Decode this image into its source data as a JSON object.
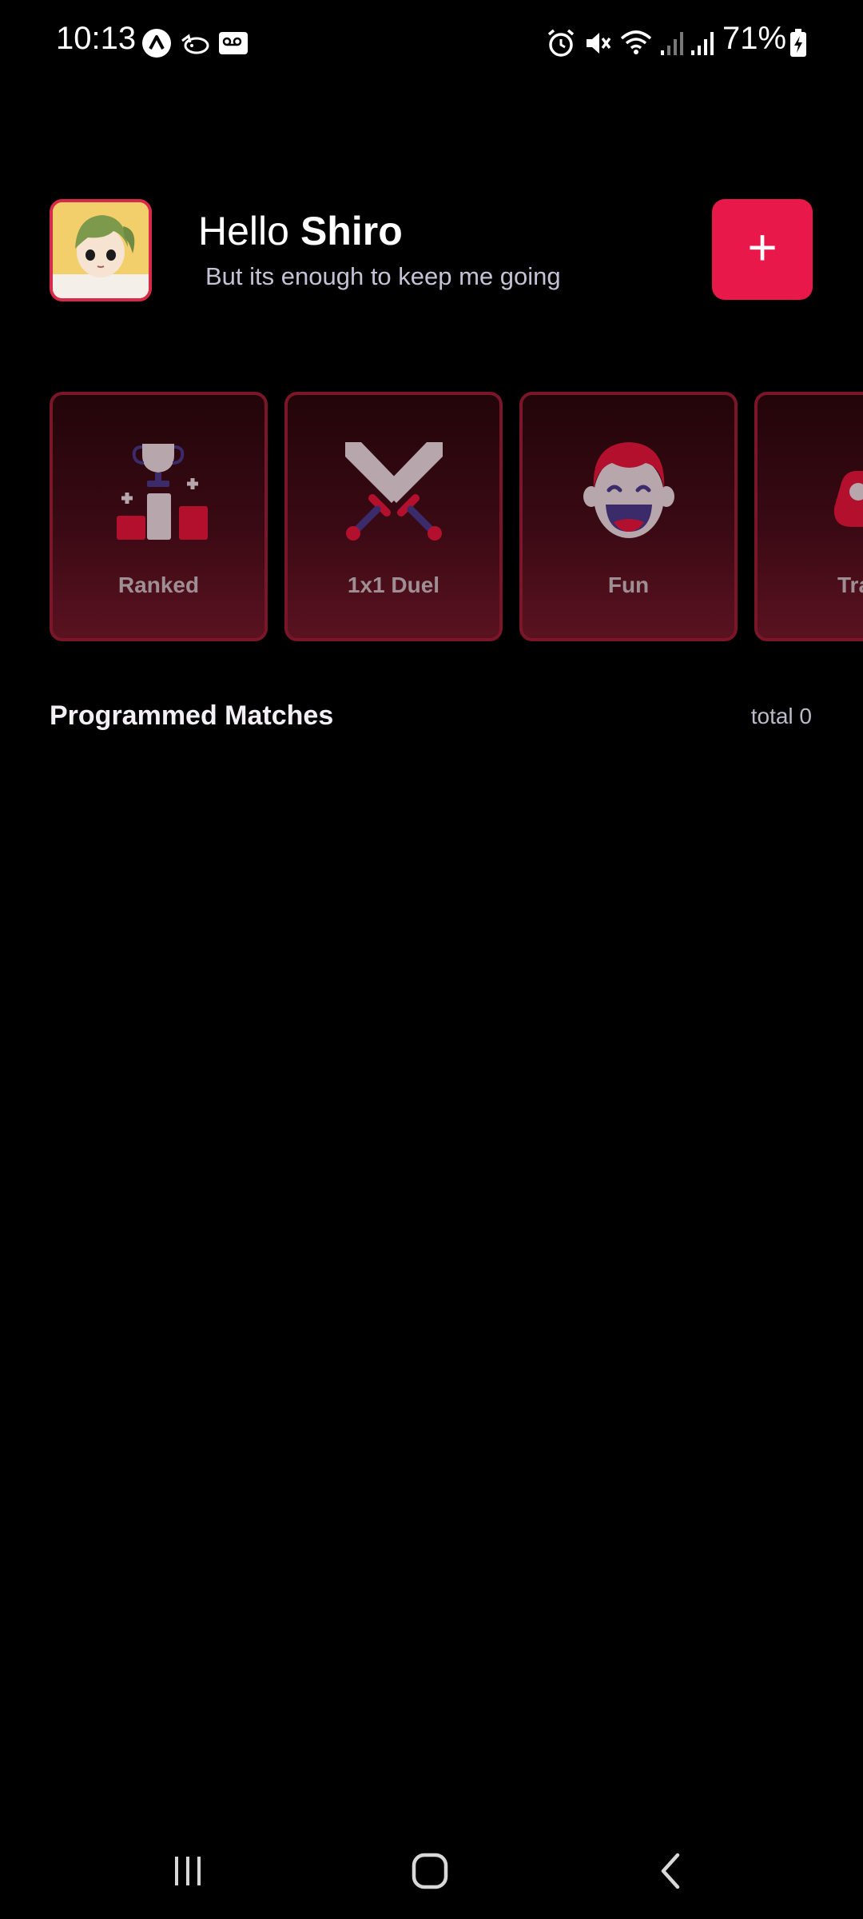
{
  "status_bar": {
    "time": "10:13",
    "battery_percent": "71%",
    "icons": [
      "app-a-icon",
      "cat-icon",
      "voicemail-icon",
      "alarm-icon",
      "mute-icon",
      "wifi-icon",
      "signal-icon",
      "signal-icon",
      "battery-charging-icon"
    ]
  },
  "header": {
    "hello": "Hello",
    "username": "Shiro",
    "subtitle": "But its enough to keep me going",
    "add_label": "+"
  },
  "modes": [
    {
      "label": "Ranked",
      "icon": "podium-trophy-icon"
    },
    {
      "label": "1x1 Duel",
      "icon": "crossed-swords-icon"
    },
    {
      "label": "Fun",
      "icon": "laughing-face-icon"
    },
    {
      "label": "Tra",
      "icon": "gamepad-icon"
    }
  ],
  "matches": {
    "title": "Programmed Matches",
    "total": "total 0"
  },
  "colors": {
    "accent": "#e8194a",
    "card_border": "#7a1628",
    "background": "#000000"
  },
  "nav": {
    "icons": [
      "recent-apps-icon",
      "home-icon",
      "back-icon"
    ]
  }
}
